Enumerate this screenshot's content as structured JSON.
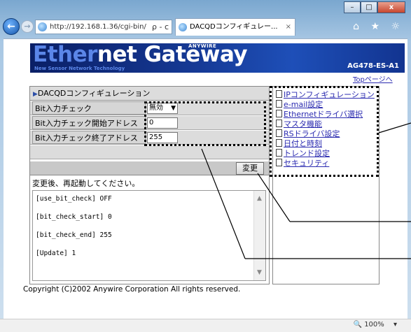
{
  "browser": {
    "address": "http://192.168.1.36/cgi-bin/",
    "address_tail": "ρ - c",
    "tab_title": "DACQDコンフィギュレー...",
    "tab_close": "×",
    "toolbar_icons": "⌂ ★ ☼",
    "window_buttons": {
      "minimize": "–",
      "maximize": "□",
      "close": "x"
    },
    "zoom": "100%",
    "zoom_arrow": "▾"
  },
  "header": {
    "logo_part1": "Ether",
    "logo_part2": "net Gateway",
    "logo_anywire": "ANYWIRE",
    "logo_sub": "New Sensor Network Technology",
    "model": "AG478-ES-A1",
    "top_link": "Topページへ"
  },
  "config": {
    "title": "DACQDコンフィギュレーション",
    "rows": [
      {
        "label": "Bit入力チェック",
        "type": "select",
        "value": "無効"
      },
      {
        "label": "Bit入力チェック開始アドレス",
        "type": "input",
        "value": "0"
      },
      {
        "label": "Bit入力チェック終了アドレス",
        "type": "input",
        "value": "255"
      }
    ],
    "change_button": "変更",
    "restart_message": "変更後、再起動してください。",
    "log_lines": [
      "[use_bit_check] OFF",
      "[bit_check_start] 0",
      "[bit_check_end] 255",
      "[Update] 1"
    ]
  },
  "menu": {
    "items": [
      "IPコンフィギュレーション",
      "e-mail設定",
      "Ethernetドライバ選択",
      "マスタ機能",
      "RSドライバ設定",
      "日付と時刻",
      "トレンド設定",
      "セキュリティ"
    ]
  },
  "footer": {
    "copyright": "Copyright (C)2002 Anywire Corporation All rights reserved."
  }
}
